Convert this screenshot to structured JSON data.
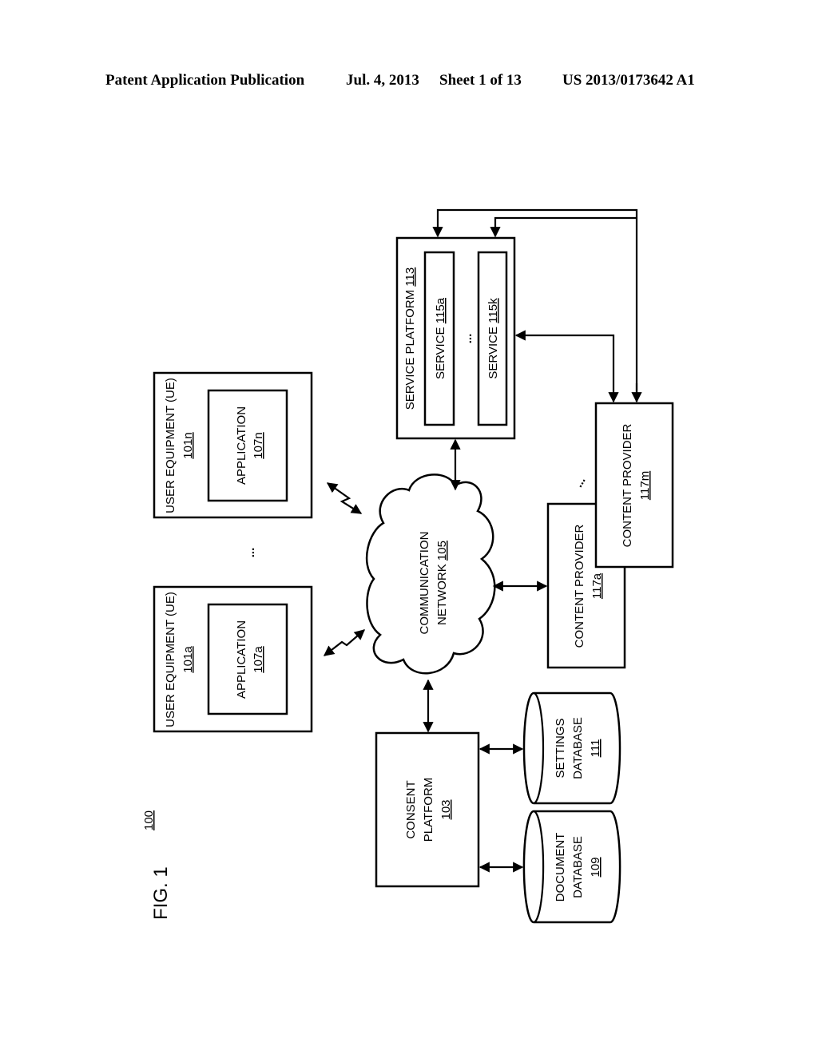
{
  "header": {
    "publication": "Patent Application Publication",
    "date": "Jul. 4, 2013",
    "sheet": "Sheet 1 of 13",
    "number": "US 2013/0173642 A1"
  },
  "figure": {
    "label": "FIG. 1",
    "ref": "100"
  },
  "ue_n": {
    "title": "USER EQUIPMENT (UE)",
    "ref": "101n",
    "app_title": "APPLICATION",
    "app_ref": "107n"
  },
  "ue_a": {
    "title": "USER EQUIPMENT (UE)",
    "ref": "101a",
    "app_title": "APPLICATION",
    "app_ref": "107a"
  },
  "ue_ellipsis": "...",
  "network": {
    "line1": "COMMUNICATION",
    "line2": "NETWORK",
    "ref": "105"
  },
  "service_platform": {
    "title": "SERVICE PLATFORM",
    "ref": "113",
    "services": [
      {
        "title": "SERVICE",
        "ref": "115a"
      },
      {
        "title": "SERVICE",
        "ref": "115k"
      }
    ],
    "ellipsis": "..."
  },
  "content_providers": [
    {
      "title": "CONTENT PROVIDER",
      "ref": "117a"
    },
    {
      "title": "CONTENT PROVIDER",
      "ref": "117m"
    }
  ],
  "provider_ellipsis": "...",
  "consent_platform": {
    "line1": "CONSENT",
    "line2": "PLATFORM",
    "ref": "103"
  },
  "settings_db": {
    "line1": "SETTINGS",
    "line2": "DATABASE",
    "ref": "111"
  },
  "document_db": {
    "line1": "DOCUMENT",
    "line2": "DATABASE",
    "ref": "109"
  }
}
